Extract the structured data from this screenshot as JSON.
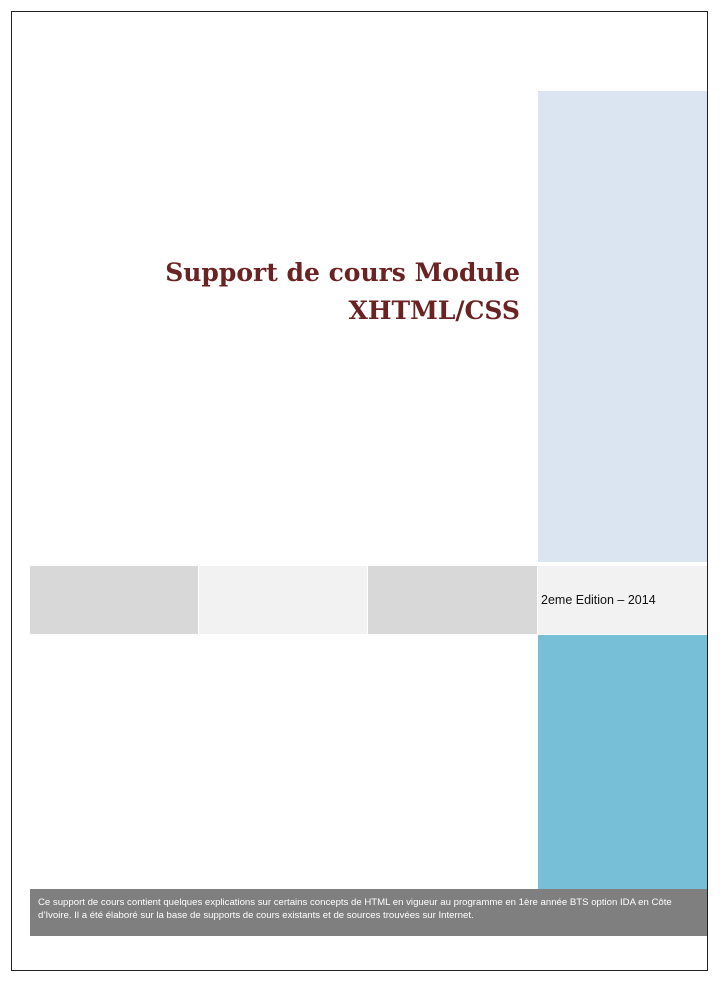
{
  "document": {
    "title_line_1": "Support de cours Module",
    "title_line_2": "XHTML/CSS",
    "edition": "2eme Edition – 2014",
    "description": "Ce support de cours contient quelques explications sur certains concepts de HTML en vigueur au programme en 1ère année BTS option IDA en Côte d’Ivoire. Il a été élaboré sur la base de supports de cours existants et de sources trouvées sur Internet."
  },
  "colors": {
    "title": "#6b2222",
    "right_column_top": "#dbe5f1",
    "right_column_bottom": "#77bfd6",
    "band_dark": "#d8d8d8",
    "band_light": "#f2f2f2",
    "footer_bar": "#7f7f7f",
    "frame_border": "#222222"
  }
}
